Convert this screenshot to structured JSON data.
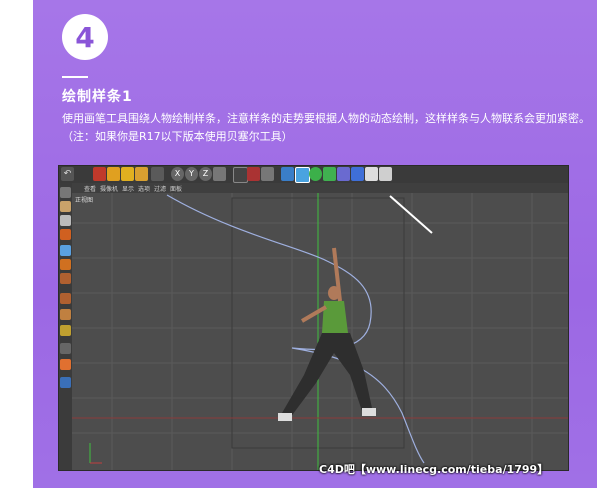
{
  "step": {
    "number": "4"
  },
  "title": "绘制样条1",
  "description": "使用画笔工具围绕人物绘制样条，注意样条的走势要根据人物的动态绘制，这样样条与人物联系会更加紧密。（注：如果你是R17以下版本使用贝塞尔工具）",
  "app": {
    "menu": [
      "查看",
      "摄像机",
      "显示",
      "选项",
      "过滤",
      "面板"
    ],
    "viewport_label": "正视图",
    "toolbar_icons": [
      "undo-icon",
      "move-icon",
      "scale-icon",
      "rotate-icon",
      "select-icon",
      "x-axis-icon",
      "y-axis-icon",
      "z-axis-icon",
      "world-icon",
      "render-icon",
      "render-view-icon",
      "render-settings-icon",
      "cube-icon",
      "pen-icon",
      "sphere-icon",
      "nurbs-icon",
      "deformer-icon",
      "light-icon",
      "camera-icon",
      "scene-icon"
    ]
  },
  "watermark": "C4D吧【www.linecg.com/tieba/1799】",
  "colors": {
    "accent": "#9c68e4",
    "viewport": "#4d4d4d",
    "spline": "#8fa3d8",
    "y_axis": "#3fbf3f",
    "x_axis": "#c04040"
  }
}
